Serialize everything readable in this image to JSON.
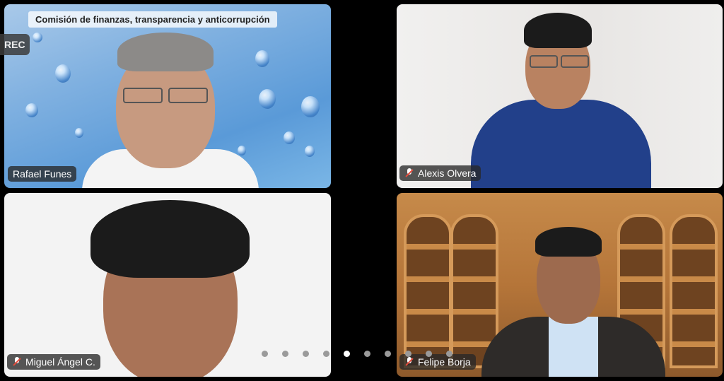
{
  "app": {
    "rec_label": "REC"
  },
  "participants": [
    {
      "name": "Rafael Funes",
      "muted": false,
      "caption": "Comisión de finanzas, transparencia y anticorrupción"
    },
    {
      "name": "Alexis Olvera",
      "muted": true
    },
    {
      "name": "Miguel Ángel C.",
      "muted": true
    },
    {
      "name": "Felipe Borja",
      "muted": true
    }
  ],
  "pagination": {
    "total": 10,
    "active_index": 4
  },
  "colors": {
    "mute_indicator": "#e74c3c",
    "badge_bg": "#282828"
  }
}
